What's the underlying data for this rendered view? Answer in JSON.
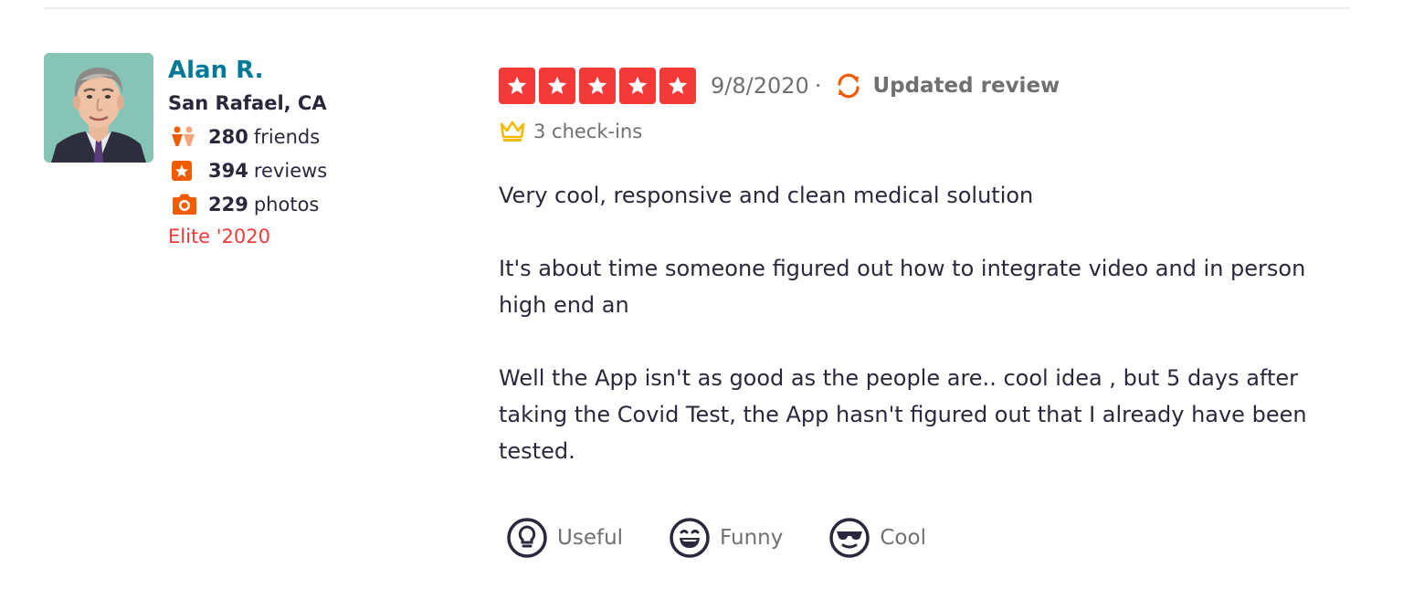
{
  "user": {
    "name": "Alan R.",
    "location": "San Rafael, CA",
    "friends_count": "280",
    "friends_label": "friends",
    "reviews_count": "394",
    "reviews_label": "reviews",
    "photos_count": "229",
    "photos_label": "photos",
    "elite": "Elite '2020"
  },
  "review": {
    "rating": 5,
    "date": "9/8/2020",
    "separator": "·",
    "updated_label": "Updated review",
    "checkins": "3 check-ins",
    "paragraphs": [
      "Very cool, responsive and clean medical solution",
      "It's about time someone figured out how to integrate video and in person high end an",
      "Well the App isn't as good as the people are.. cool idea , but 5 days after taking the Covid Test, the App hasn't figured out that I already have been tested."
    ]
  },
  "reactions": {
    "useful": "Useful",
    "funny": "Funny",
    "cool": "Cool"
  },
  "icons": {
    "friends": "friends-icon",
    "reviews": "star-badge-icon",
    "photos": "camera-icon",
    "updated": "refresh-icon",
    "checkins": "crown-icon",
    "useful": "lightbulb-icon",
    "funny": "laughing-face-icon",
    "cool": "sunglasses-face-icon"
  },
  "colors": {
    "star_red": "#f43939",
    "name_teal": "#027a97",
    "elite_red": "#f43939",
    "orange_icon": "#f15c00",
    "crown_gold": "#f5b800"
  }
}
